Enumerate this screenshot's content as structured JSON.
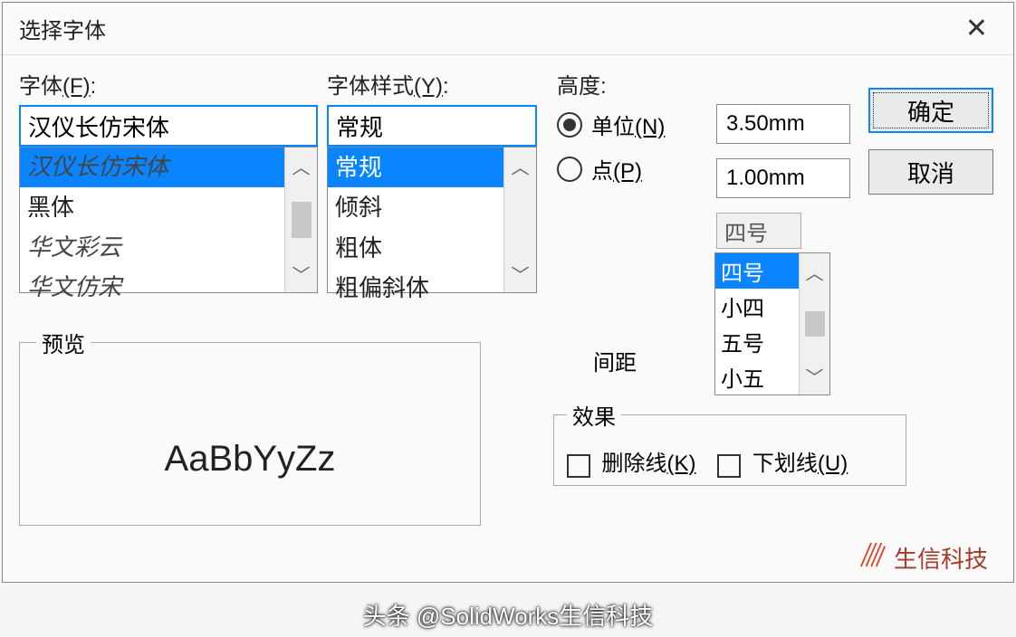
{
  "title": "选择字体",
  "font": {
    "label_pre": "字体",
    "label_key": "(F)",
    "label_post": ":",
    "value": "汉仪长仿宋体",
    "items": [
      "汉仪长仿宋体",
      "黑体",
      "华文彩云",
      "华文仿宋"
    ]
  },
  "style": {
    "label_pre": "字体样式",
    "label_key": "(Y)",
    "label_post": ":",
    "value": "常规",
    "items": [
      "常规",
      "倾斜",
      "粗体",
      "粗偏斜体"
    ]
  },
  "height": {
    "label": "高度:",
    "unit_pre": "单位",
    "unit_key": "(N)",
    "point_pre": "点",
    "point_key": "(P)",
    "unit_value": "3.50mm",
    "point_value": "1.00mm",
    "size_value": "四号",
    "sizes": [
      "四号",
      "小四",
      "五号",
      "小五"
    ],
    "spacing_label": "间距"
  },
  "buttons": {
    "ok": "确定",
    "cancel": "取消"
  },
  "preview": {
    "label": "预览",
    "sample": "AaBbYyZz"
  },
  "effects": {
    "label": "效果",
    "strike_pre": "删除线",
    "strike_key": "(K)",
    "underline_pre": "下划线",
    "underline_key": "(U)"
  },
  "watermark": "生信科技",
  "footer": "头条 @SolidWorks生信科技"
}
